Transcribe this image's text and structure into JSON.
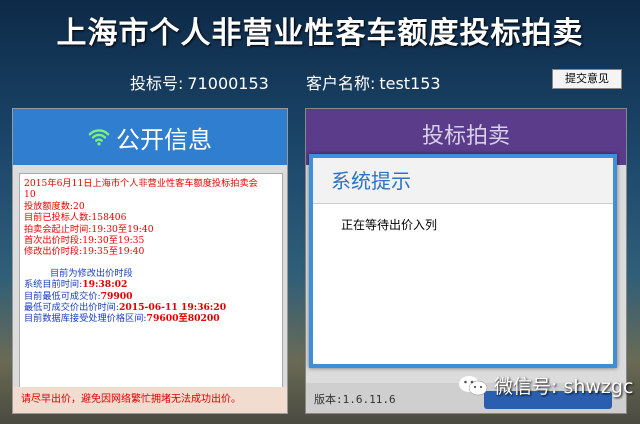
{
  "title": "上海市个人非营业性客车额度投标拍卖",
  "bidder": {
    "bid_no_label": "投标号:",
    "bid_no": "71000153",
    "name_label": "客户名称:",
    "name": "test153"
  },
  "submit_button": "提交意见",
  "public_info": {
    "header": "公开信息",
    "lines": {
      "l1": "2015年6月11日上海市个人非营业性客车额度投标拍卖会",
      "l2": "10",
      "l3": "投放额度数:20",
      "l4": "目前已投标人数:158406",
      "l5": "拍卖会起止时间:19:30至19:40",
      "l6": "首次出价时段:19:30至19:35",
      "l7": "修改出价时段:19:35至19:40",
      "l8": "目前为修改出价时段",
      "l9_label": "系统目前时间:",
      "l9_value": "19:38:02",
      "l10_label": "目前最低可成交价:",
      "l10_value": "79900",
      "l11_label": "最低可成交价出价时间:",
      "l11_value": "2015-06-11 19:36:20",
      "l12_label": "目前数据库接受处理价格区间:",
      "l12_value": "79600至80200"
    },
    "footer": "请尽早出价，避免因网络繁忙拥堵无法成功出价。"
  },
  "bidding": {
    "header": "投标拍卖",
    "version": "版本:1.6.11.6"
  },
  "dialog": {
    "title": "系统提示",
    "message": "正在等待出价入列"
  },
  "watermark": {
    "text": "微信号: shwzgc"
  },
  "colors": {
    "left_header": "#2f7ecf",
    "right_header": "#5a3c8a",
    "dialog_border": "#3e8fd9",
    "info_red": "#e00000",
    "info_blue": "#1a3ec0"
  }
}
